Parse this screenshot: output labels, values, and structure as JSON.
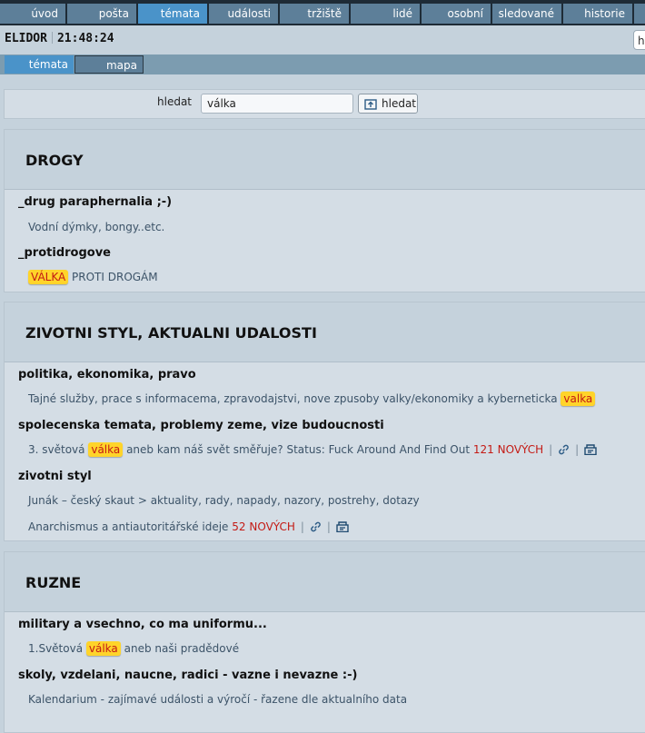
{
  "nav": {
    "tabs": [
      "úvod",
      "pošta",
      "témata",
      "události",
      "tržiště",
      "lidé",
      "osobní",
      "sledované",
      "historie"
    ],
    "active": "témata"
  },
  "header": {
    "brand": "ELIDOR",
    "clock": "21:48:24",
    "search_peek": "h"
  },
  "subtabs": {
    "topics": "témata",
    "map": "mapa"
  },
  "search": {
    "label": "hledat",
    "value": "válka",
    "button": "hledat"
  },
  "sections": {
    "drogy": {
      "title": "DROGY",
      "g1": {
        "title": "_drug paraphernalia ;-)",
        "f1": "Vodní dýmky, bongy..etc."
      },
      "g2": {
        "title": "_protidrogove",
        "f1_hl": "VÁLKA",
        "f1_rest": "PROTI DROGÁM"
      }
    },
    "zivot": {
      "title": "ZIVOTNI STYL, AKTUALNI UDALOSTI",
      "g1": {
        "title": "politika, ekonomika, pravo",
        "f1_pre": "Tajné služby, prace s informacema, zpravodajstvi, nove zpusoby valky/ekonomiky a kyberneticka",
        "f1_hl": "valka"
      },
      "g2": {
        "title": "spolecenska temata, problemy zeme, vize budoucnosti",
        "f1_pre": "3. světová",
        "f1_hl": "válka",
        "f1_post": "aneb kam náš svět směřuje? Status: Fuck Around And Find Out",
        "f1_new": "121 NOVÝCH"
      },
      "g3": {
        "title": "zivotni styl",
        "f1": "Junák – český skaut > aktuality, rady, napady, nazory, postrehy, dotazy",
        "f2": "Anarchismus a antiautoritářské ideje",
        "f2_new": "52 NOVÝCH"
      }
    },
    "ruzne": {
      "title": "RUZNE",
      "g1": {
        "title": "military a vsechno, co ma uniformu...",
        "f1_pre": "1.Světová",
        "f1_hl": "válka",
        "f1_post": "aneb naši pradědové"
      },
      "g2": {
        "title": "skoly, vzdelani, naucne, radici - vazne i nevazne :-)",
        "f1": "Kalendarium - zajímavé události a výročí - řazene dle aktualního data"
      }
    }
  },
  "icons": [
    "link-icon",
    "bookmark-icon",
    "search-submit-icon"
  ],
  "colors": {
    "accent": "#4a93c9",
    "nav_bg": "#1e2b36",
    "tab_bg": "#5d7f99",
    "highlight": "#ffd42a",
    "new_red": "#c41a14"
  }
}
